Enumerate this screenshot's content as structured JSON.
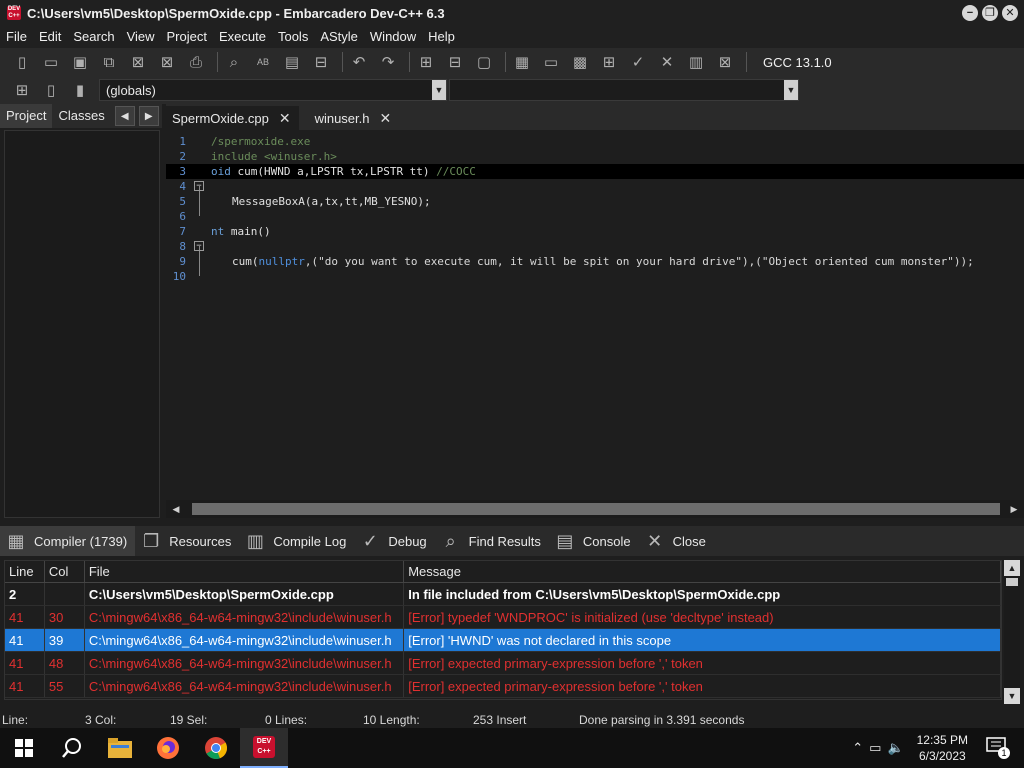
{
  "window": {
    "title": "C:\\Users\\vm5\\Desktop\\SpermOxide.cpp - Embarcadero Dev-C++ 6.3",
    "app_icon_text": "DEV C++",
    "minimize": "−",
    "restore": "❐",
    "close": "✕"
  },
  "menu": [
    "File",
    "Edit",
    "Search",
    "View",
    "Project",
    "Execute",
    "Tools",
    "AStyle",
    "Window",
    "Help"
  ],
  "toolbar": {
    "compiler": "GCC 13.1.0",
    "scope_combo": "(globals)",
    "second_combo": ""
  },
  "left_panel": {
    "tabs": [
      "Project",
      "Classes"
    ],
    "prev": "◀",
    "next": "▶"
  },
  "editor_tabs": [
    {
      "label": "SpermOxide.cpp",
      "close": "✕"
    },
    {
      "label": "winuser.h",
      "close": "✕"
    }
  ],
  "code": {
    "line_numbers": [
      "1",
      "2",
      "3",
      "4",
      "5",
      "6",
      "7",
      "8",
      "9",
      "10"
    ],
    "l1": "/spermoxide.exe",
    "l2": "include <winuser.h>",
    "l3_kw": "oid",
    "l3_code": " cum(HWND a,LPSTR tx,LPSTR tt) ",
    "l3_comment": "//COCC",
    "l5": "MessageBoxA(a,tx,tt,MB_YESNO);",
    "l7_kw": "nt",
    "l7_code": " main()",
    "l9_a": "cum(",
    "l9_b": "nullptr",
    "l9_c": ",(\"do you want to execute cum, it will be spit on your hard drive\"),(\"Object oriented cum monster\"));",
    "fold_symbol": "−"
  },
  "bottom_tabs": [
    {
      "label": "Compiler (1739)",
      "icon": "▦"
    },
    {
      "label": "Resources",
      "icon": "❐"
    },
    {
      "label": "Compile Log",
      "icon": "▥"
    },
    {
      "label": "Debug",
      "icon": "✓"
    },
    {
      "label": "Find Results",
      "icon": "⌕"
    },
    {
      "label": "Console",
      "icon": "▤"
    },
    {
      "label": "Close",
      "icon": "✕"
    }
  ],
  "messages": {
    "headers": [
      "Line",
      "Col",
      "File",
      "Message"
    ],
    "rows": [
      {
        "line": "2",
        "col": "",
        "file": "C:\\Users\\vm5\\Desktop\\SpermOxide.cpp",
        "message": "In file included from C:\\Users\\vm5\\Desktop\\SpermOxide.cpp"
      },
      {
        "line": "41",
        "col": "30",
        "file": "C:\\mingw64\\x86_64-w64-mingw32\\include\\winuser.h",
        "message": "[Error] typedef 'WNDPROC' is initialized (use 'decltype' instead)"
      },
      {
        "line": "41",
        "col": "39",
        "file": "C:\\mingw64\\x86_64-w64-mingw32\\include\\winuser.h",
        "message": "[Error] 'HWND' was not declared in this scope"
      },
      {
        "line": "41",
        "col": "48",
        "file": "C:\\mingw64\\x86_64-w64-mingw32\\include\\winuser.h",
        "message": "[Error] expected primary-expression before ',' token"
      },
      {
        "line": "41",
        "col": "55",
        "file": "C:\\mingw64\\x86_64-w64-mingw32\\include\\winuser.h",
        "message": "[Error] expected primary-expression before ',' token"
      }
    ],
    "scroll_up": "▲",
    "scroll_down": "▼"
  },
  "status": {
    "line": "Line:",
    "col": "3 Col:",
    "sel": "19 Sel:",
    "lines": "0 Lines:",
    "length": "10 Length:",
    "insert": "253 Insert",
    "message": "Done parsing in 3.391 seconds"
  },
  "taskbar": {
    "time": "12:35 PM",
    "date": "6/3/2023",
    "notification_count": "1",
    "dev_label": "DEV C++"
  },
  "colors": {
    "selection": "#1e78d4",
    "error": "#e03030",
    "line_number": "#5f8fd0"
  }
}
